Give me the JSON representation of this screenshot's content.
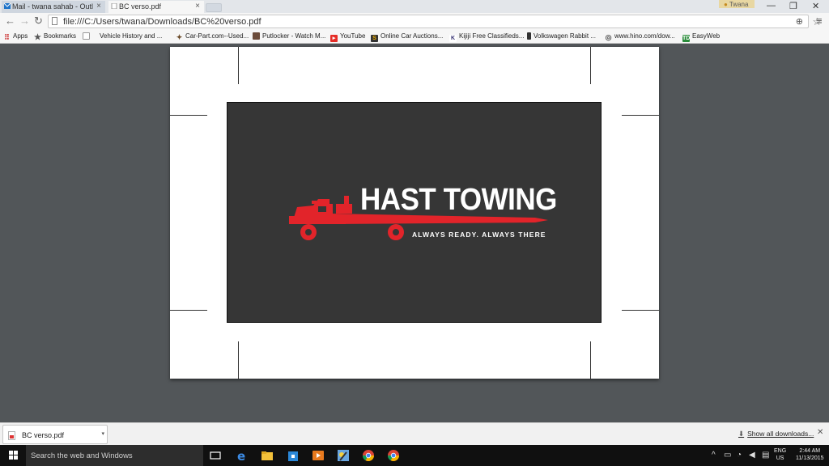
{
  "browser": {
    "tabs": [
      {
        "title": "Mail - twana sahab - Outl",
        "active": false
      },
      {
        "title": "BC verso.pdf",
        "active": true
      }
    ],
    "profile_name": "Twana",
    "address": "file:///C:/Users/twana/Downloads/BC%20verso.pdf",
    "bookmarks": [
      {
        "label": "Apps",
        "icon": "apps-grid-icon"
      },
      {
        "label": "Bookmarks",
        "icon": "star-icon"
      },
      {
        "label": "Vehicle History and ...",
        "icon": "page-icon"
      },
      {
        "label": "Car-Part.com--Used...",
        "icon": "car-part-icon"
      },
      {
        "label": "Putlocker - Watch M...",
        "icon": "putlocker-icon"
      },
      {
        "label": "YouTube",
        "icon": "youtube-icon"
      },
      {
        "label": "Online Car Auctions...",
        "icon": "s-logo-icon"
      },
      {
        "label": "Kijiji Free Classifieds...",
        "icon": "kijiji-icon"
      },
      {
        "label": "Volkswagen Rabbit ...",
        "icon": "phone-icon"
      },
      {
        "label": "www.hino.com/dow...",
        "icon": "globe-icon"
      },
      {
        "label": "EasyWeb",
        "icon": "td-icon"
      }
    ]
  },
  "document": {
    "brand_name": "HAST TOWING",
    "tagline": "ALWAYS READY. ALWAYS THERE",
    "colors": {
      "card": "#363636",
      "truck": "#e2242a",
      "text": "#ffffff"
    }
  },
  "downloads": {
    "file_name": "BC verso.pdf",
    "show_all_label": "Show all downloads..."
  },
  "taskbar": {
    "search_placeholder": "Search the web and Windows",
    "language": "ENG",
    "region": "US",
    "time": "2:44 AM",
    "date": "11/13/2015"
  }
}
